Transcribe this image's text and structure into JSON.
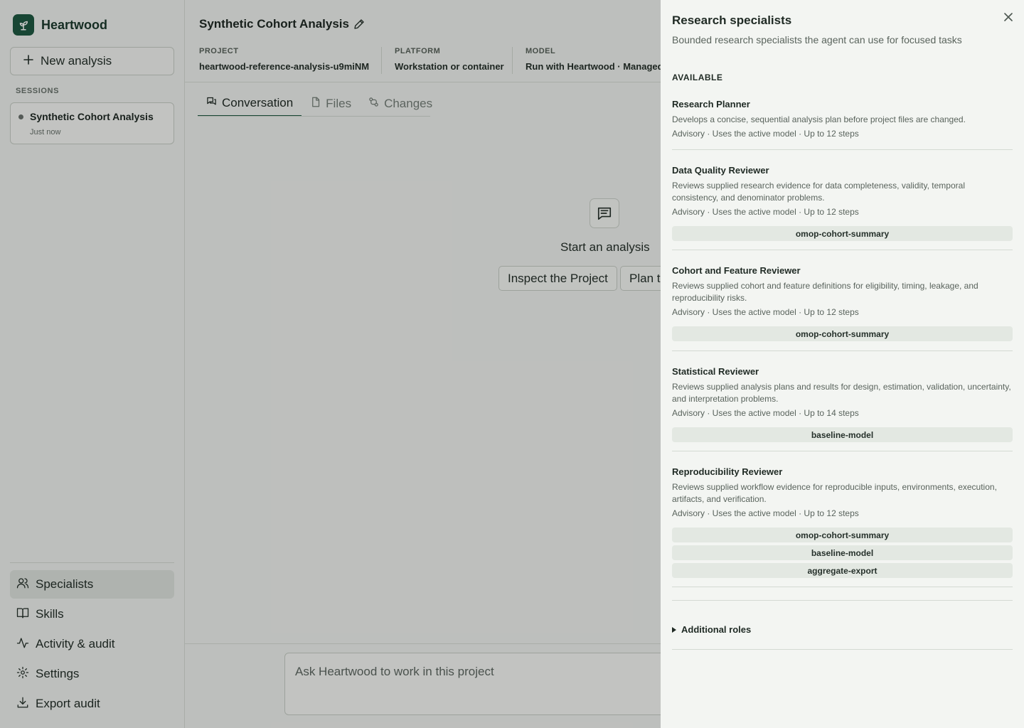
{
  "brand": {
    "name": "Heartwood"
  },
  "sidebar": {
    "new_button": "New analysis",
    "sessions_label": "SESSIONS",
    "session": {
      "title": "Synthetic Cohort Analysis",
      "time": "Just now"
    },
    "nav": [
      {
        "label": "Specialists",
        "icon": "people-icon",
        "active": true
      },
      {
        "label": "Skills",
        "icon": "book-icon"
      },
      {
        "label": "Activity & audit",
        "icon": "activity-icon"
      },
      {
        "label": "Settings",
        "icon": "gear-icon"
      },
      {
        "label": "Export audit",
        "icon": "download-icon"
      }
    ]
  },
  "header": {
    "title": "Synthetic Cohort Analysis",
    "meta": [
      {
        "label": "PROJECT",
        "value": "heartwood-reference-analysis-u9miNM"
      },
      {
        "label": "PLATFORM",
        "value": "Workstation or container"
      },
      {
        "label": "MODEL",
        "value": "Run with Heartwood · Managed"
      }
    ]
  },
  "tabs": [
    {
      "label": "Conversation",
      "icon": "chat-icon",
      "active": true
    },
    {
      "label": "Files",
      "icon": "file-icon"
    },
    {
      "label": "Changes",
      "icon": "changes-icon"
    }
  ],
  "empty": {
    "title": "Start an analysis",
    "suggestions": [
      "Inspect the Project",
      "Plan th"
    ]
  },
  "composer": {
    "placeholder": "Ask Heartwood to work in this project"
  },
  "drawer": {
    "title": "Research specialists",
    "subtitle": "Bounded research specialists the agent can use for focused tasks",
    "available_label": "AVAILABLE",
    "specialists": [
      {
        "name": "Research Planner",
        "description": "Develops a concise, sequential analysis plan before project files are changed.",
        "meta": "Advisory · Uses the active model · Up to 12 steps",
        "tools": []
      },
      {
        "name": "Data Quality Reviewer",
        "description": "Reviews supplied research evidence for data completeness, validity, temporal consistency, and denominator problems.",
        "meta": "Advisory · Uses the active model · Up to 12 steps",
        "tools": [
          "omop-cohort-summary"
        ]
      },
      {
        "name": "Cohort and Feature Reviewer",
        "description": "Reviews supplied cohort and feature definitions for eligibility, timing, leakage, and reproducibility risks.",
        "meta": "Advisory · Uses the active model · Up to 12 steps",
        "tools": [
          "omop-cohort-summary"
        ]
      },
      {
        "name": "Statistical Reviewer",
        "description": "Reviews supplied analysis plans and results for design, estimation, validation, uncertainty, and interpretation problems.",
        "meta": "Advisory · Uses the active model · Up to 14 steps",
        "tools": [
          "baseline-model"
        ]
      },
      {
        "name": "Reproducibility Reviewer",
        "description": "Reviews supplied workflow evidence for reproducible inputs, environments, execution, artifacts, and verification.",
        "meta": "Advisory · Uses the active model · Up to 12 steps",
        "tools": [
          "omop-cohort-summary",
          "baseline-model",
          "aggregate-export"
        ]
      }
    ],
    "additional_roles": "Additional roles"
  }
}
